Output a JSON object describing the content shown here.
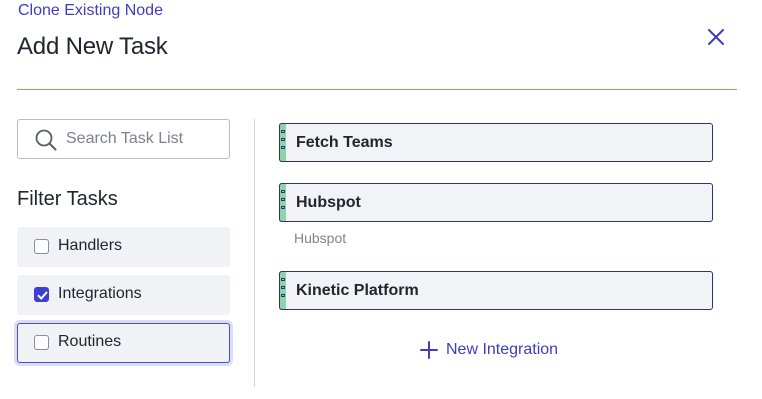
{
  "header": {
    "clone_link": "Clone Existing Node",
    "title": "Add New Task"
  },
  "search": {
    "placeholder": "Search Task List",
    "value": ""
  },
  "filters": {
    "heading": "Filter Tasks",
    "items": [
      {
        "label": "Handlers",
        "checked": false
      },
      {
        "label": "Integrations",
        "checked": true
      },
      {
        "label": "Routines",
        "checked": false
      }
    ]
  },
  "tasks": [
    {
      "name": "Fetch Teams"
    },
    {
      "name": "Hubspot",
      "subtitle": "Hubspot"
    },
    {
      "name": "Kinetic Platform"
    }
  ],
  "actions": {
    "new_integration": "New Integration"
  },
  "colors": {
    "accent": "#3f3dbd",
    "divider": "#d98a4e",
    "handle": "#8fd3ad",
    "task_border": "#2c3570"
  },
  "icons": {
    "close": "close-icon",
    "search": "search-icon",
    "add": "plus-icon",
    "checkbox_checked": "checkmark-icon",
    "drag": "drag-handle-icon"
  }
}
